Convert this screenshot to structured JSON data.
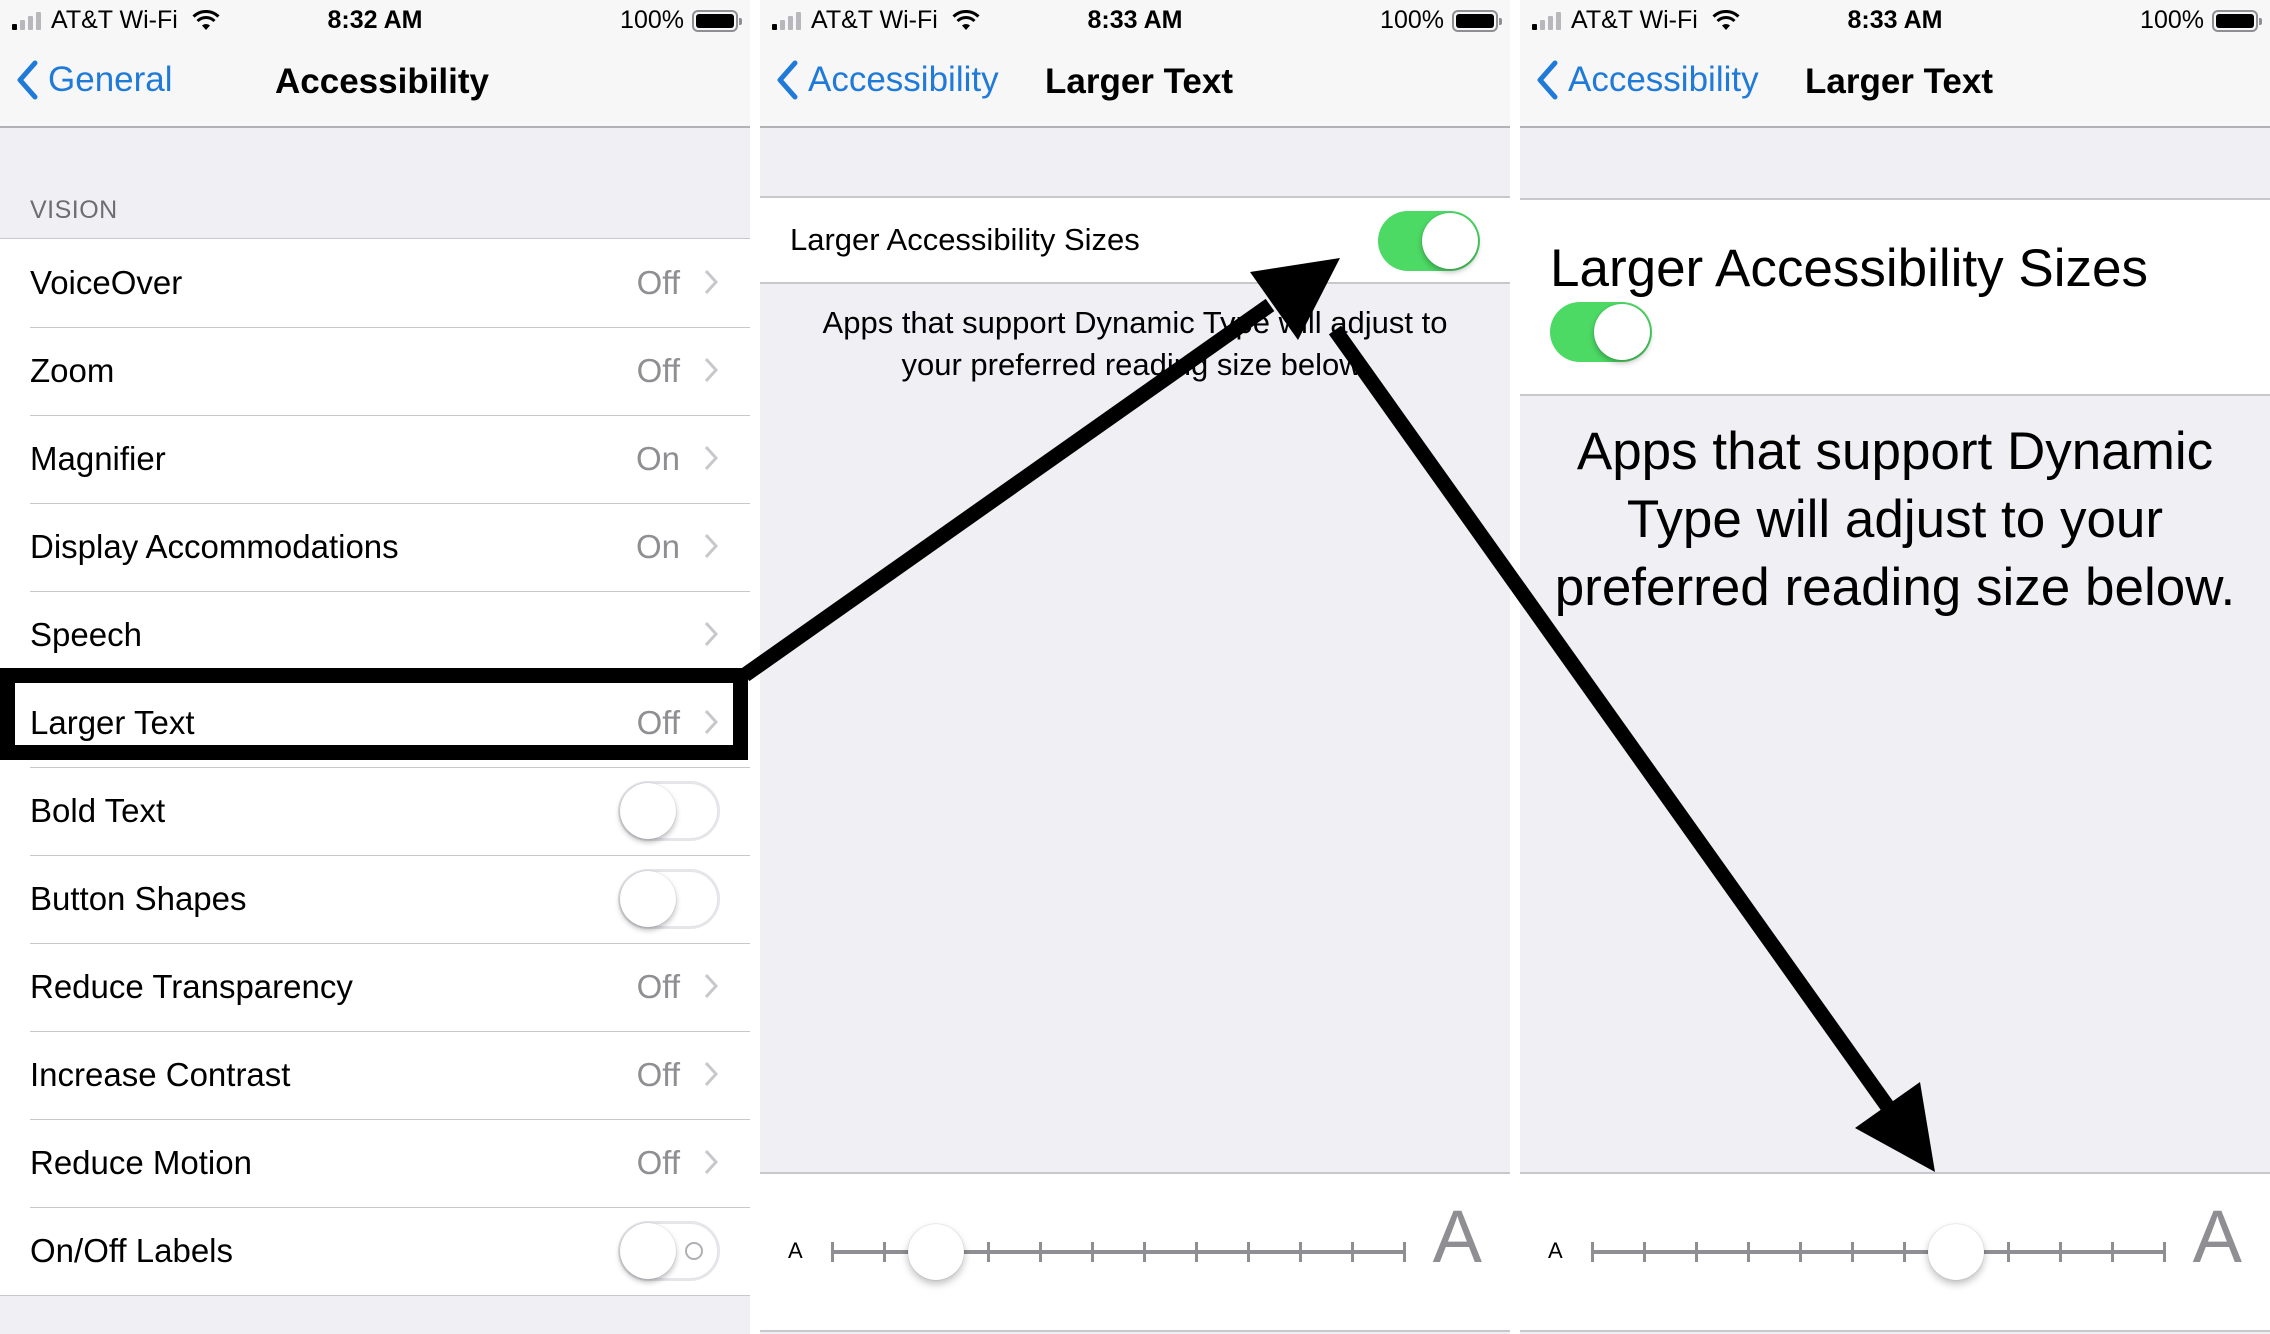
{
  "colors": {
    "accent_blue": "#1f7ad8",
    "toggle_on": "#4cd964",
    "secondary_text": "#8e8e93",
    "group_bg": "#efeff4"
  },
  "panels": [
    {
      "status": {
        "carrier": "AT&T Wi-Fi",
        "time": "8:32 AM",
        "battery": "100%"
      },
      "nav": {
        "back": "General",
        "title": "Accessibility"
      },
      "section_header": "VISION",
      "rows": [
        {
          "label": "VoiceOver",
          "value": "Off",
          "type": "disclosure"
        },
        {
          "label": "Zoom",
          "value": "Off",
          "type": "disclosure"
        },
        {
          "label": "Magnifier",
          "value": "On",
          "type": "disclosure"
        },
        {
          "label": "Display Accommodations",
          "value": "On",
          "type": "disclosure"
        },
        {
          "label": "Speech",
          "value": "",
          "type": "disclosure"
        },
        {
          "label": "Larger Text",
          "value": "Off",
          "type": "disclosure",
          "highlighted": true
        },
        {
          "label": "Bold Text",
          "type": "toggle",
          "on": false
        },
        {
          "label": "Button Shapes",
          "type": "toggle",
          "on": false
        },
        {
          "label": "Reduce Transparency",
          "value": "Off",
          "type": "disclosure"
        },
        {
          "label": "Increase Contrast",
          "value": "Off",
          "type": "disclosure"
        },
        {
          "label": "Reduce Motion",
          "value": "Off",
          "type": "disclosure"
        },
        {
          "label": "On/Off Labels",
          "type": "toggle",
          "on": false,
          "show_onoff_label": true
        }
      ]
    },
    {
      "status": {
        "carrier": "AT&T Wi-Fi",
        "time": "8:33 AM",
        "battery": "100%"
      },
      "nav": {
        "back": "Accessibility",
        "title": "Larger Text"
      },
      "larger_sizes": {
        "label": "Larger Accessibility Sizes",
        "on": true
      },
      "footer": "Apps that support Dynamic Type will adjust to your preferred reading size below.",
      "slider": {
        "min_label": "A",
        "max_label": "A",
        "steps": 12,
        "value_index": 2
      }
    },
    {
      "status": {
        "carrier": "AT&T Wi-Fi",
        "time": "8:33 AM",
        "battery": "100%"
      },
      "nav": {
        "back": "Accessibility",
        "title": "Larger Text"
      },
      "larger_sizes": {
        "label": "Larger Accessibility Sizes",
        "on": true
      },
      "footer": "Apps that support Dynamic Type will adjust to your preferred reading size below.",
      "slider": {
        "min_label": "A",
        "max_label": "A",
        "steps": 12,
        "value_index": 7
      }
    }
  ],
  "annotations": [
    {
      "type": "highlight-box",
      "target": "Larger Text row"
    },
    {
      "type": "arrow",
      "from": "Larger Text row",
      "to": "Larger Accessibility Sizes toggle"
    },
    {
      "type": "arrow",
      "from": "Larger Accessibility Sizes toggle",
      "to": "text size slider"
    }
  ]
}
